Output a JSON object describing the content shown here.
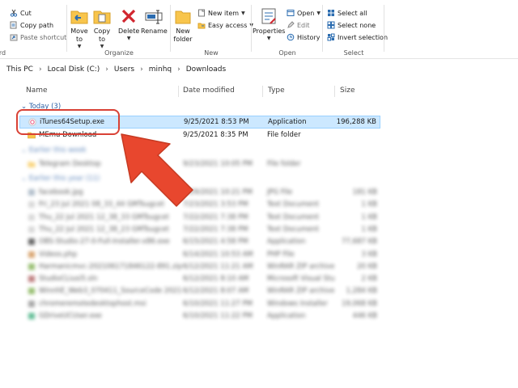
{
  "ribbon": {
    "clipboard": {
      "cut": "Cut",
      "copy_path": "Copy path",
      "paste_shortcut": "Paste shortcut"
    },
    "organize": {
      "label": "Organize",
      "move_to": "Move\nto",
      "copy_to": "Copy\nto",
      "delete": "Delete",
      "rename": "Rename"
    },
    "new": {
      "label": "New",
      "new_folder": "New\nfolder",
      "new_item": "New item",
      "easy_access": "Easy access"
    },
    "open": {
      "label": "Open",
      "properties": "Properties",
      "open": "Open",
      "edit": "Edit",
      "history": "History"
    },
    "select": {
      "label": "Select",
      "select_all": "Select all",
      "select_none": "Select none",
      "invert_selection": "Invert selection"
    },
    "cut_off_label": "rd"
  },
  "address": {
    "crumbs": [
      "This PC",
      "Local Disk (C:)",
      "Users",
      "minhq",
      "Downloads"
    ]
  },
  "columns": {
    "name": "Name",
    "date": "Date modified",
    "type": "Type",
    "size": "Size"
  },
  "groups": {
    "today": "Today (3)",
    "earlier_week": "Earlier this week",
    "earlier_year": "Earlier this year (11)"
  },
  "files": [
    {
      "name": "iTunes64Setup.exe",
      "date": "9/25/2021 8:53 PM",
      "type": "Application",
      "size": "196,288 KB"
    },
    {
      "name": "MEmu Download",
      "date": "9/25/2021 8:35 PM",
      "type": "File folder",
      "size": ""
    }
  ],
  "blurred_files": [
    {
      "name": "Telegram Desktop",
      "date": "9/23/2021 10:05 PM",
      "type": "File folder",
      "size": ""
    },
    {
      "name": "facebook.jpg",
      "date": "7/29/2021 10:21 PM",
      "type": "JPG File",
      "size": "181 KB"
    },
    {
      "name": "Fri_23 Jul 2021 08_33_44 GMTsugcet",
      "date": "7/23/2021 3:53 PM",
      "type": "Text Document",
      "size": "1 KB"
    },
    {
      "name": "Thu_22 Jul 2021 12_38_33 GMTsugcet",
      "date": "7/22/2021 7:38 PM",
      "type": "Text Document",
      "size": "1 KB"
    },
    {
      "name": "Thu_22 Jul 2021 12_38_23 GMTsugcet",
      "date": "7/22/2021 7:38 PM",
      "type": "Text Document",
      "size": "1 KB"
    },
    {
      "name": "OBS-Studio-27-0-Full-Installer-x86.exe",
      "date": "6/15/2021 4:58 PM",
      "type": "Application",
      "size": "77,687 KB"
    },
    {
      "name": "Videos.php",
      "date": "6/14/2021 10:53 AM",
      "type": "PHP File",
      "size": "3 KB"
    },
    {
      "name": "Harmanicmvc-202106171846122-891.zip",
      "date": "6/12/2021 11:21 AM",
      "type": "WinRAR ZIP archive",
      "size": "20 KB"
    },
    {
      "name": "StudioCLiusi5.sln",
      "date": "6/12/2021 8:10 AM",
      "type": "Microsoft Visual Stu",
      "size": "2 KB"
    },
    {
      "name": "WinnhE_Web3_070411_SourceCode 2021",
      "date": "6/12/2021 8:07 AM",
      "type": "WinRAR ZIP archive",
      "size": "1,284 KB"
    },
    {
      "name": "chromeremotedesktophost.msi",
      "date": "6/10/2021 11:27 PM",
      "type": "Windows Installer",
      "size": "19,068 KB"
    },
    {
      "name": "GDriveUCUser.exe",
      "date": "6/10/2021 11:22 PM",
      "type": "Application",
      "size": "446 KB"
    }
  ],
  "colors": {
    "selection_bg": "#cce8ff",
    "selection_border": "#99d1ff",
    "highlight": "#d94135",
    "arrow": "#e8472e",
    "group_header": "#2b5fa5"
  }
}
